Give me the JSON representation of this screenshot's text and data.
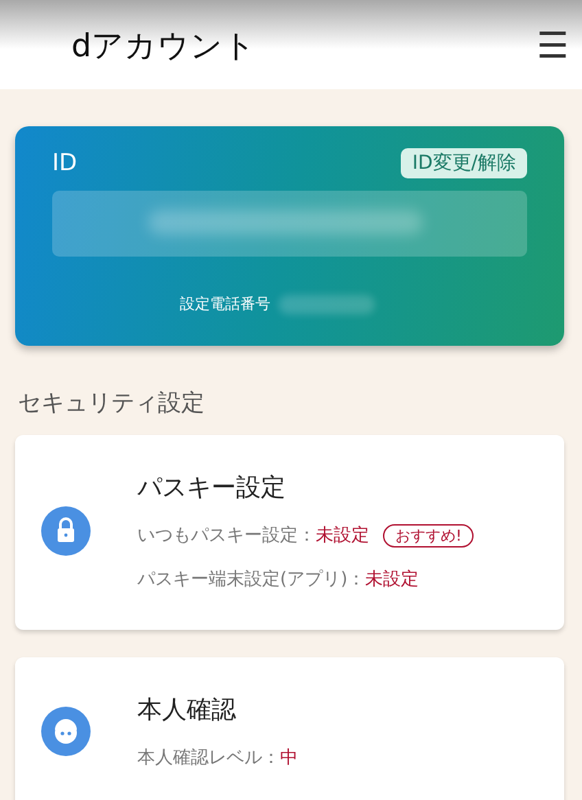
{
  "header": {
    "title": "dアカウント",
    "menu": "☰"
  },
  "id_card": {
    "label": "ID",
    "change_button": "ID変更/解除",
    "phone_label": "設定電話番号"
  },
  "section_title": "セキュリティ設定",
  "cards": [
    {
      "kind": "lock",
      "title": "パスキー設定",
      "lines": [
        {
          "label": "いつもパスキー設定：",
          "value": "未設定",
          "badge": "おすすめ!"
        },
        {
          "label": "パスキー端末設定(アプリ)：",
          "value": "未設定"
        }
      ]
    },
    {
      "kind": "face",
      "title": "本人確認",
      "lines": [
        {
          "label": "本人確認レベル：",
          "value": "中"
        }
      ]
    }
  ]
}
